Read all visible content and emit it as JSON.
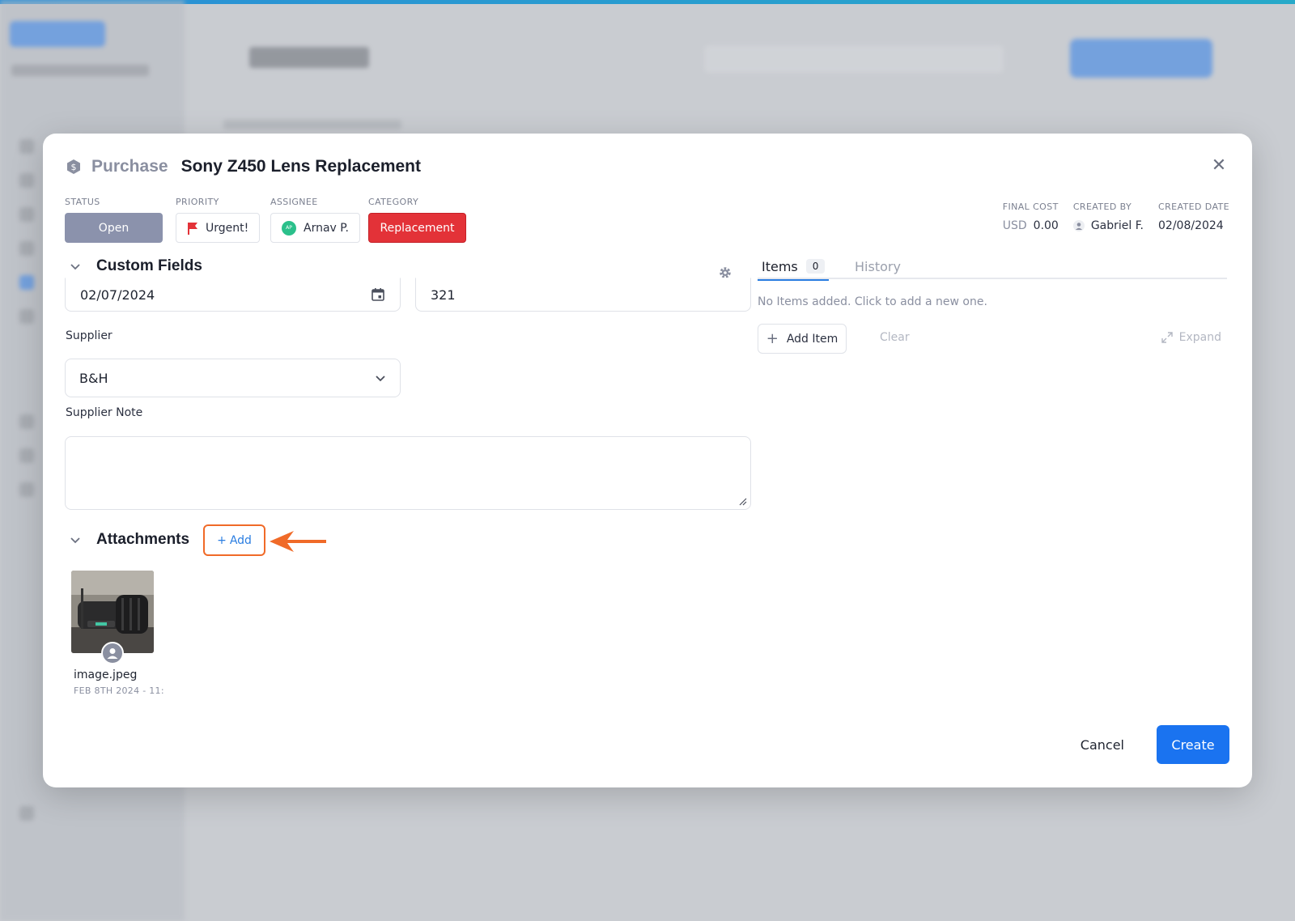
{
  "modal": {
    "type_label": "Purchase",
    "title": "Sony Z450 Lens Replacement",
    "status": {
      "label": "STATUS",
      "value": "Open"
    },
    "priority": {
      "label": "PRIORITY",
      "value": "Urgent!",
      "flag_color": "#e33238"
    },
    "assignee": {
      "label": "ASSIGNEE",
      "value": "Arnav P.",
      "initials": "AP"
    },
    "category": {
      "label": "CATEGORY",
      "value": "Replacement",
      "color": "#e33238"
    },
    "final_cost": {
      "label": "FINAL COST",
      "currency": "USD",
      "amount": "0.00"
    },
    "created_by": {
      "label": "CREATED BY",
      "value": "Gabriel F."
    },
    "created_date": {
      "label": "CREATED DATE",
      "value": "02/08/2024"
    }
  },
  "custom_fields": {
    "title": "Custom Fields",
    "date_value": "02/07/2024",
    "number_value": "321"
  },
  "supplier": {
    "label": "Supplier",
    "value": "B&H"
  },
  "supplier_note": {
    "label": "Supplier Note",
    "value": ""
  },
  "attachments": {
    "title": "Attachments",
    "add_label": "Add",
    "files": [
      {
        "name": "image.jpeg",
        "date": "FEB 8TH 2024 - 11:"
      }
    ]
  },
  "items_panel": {
    "tabs": [
      {
        "label": "Items",
        "count": "0"
      },
      {
        "label": "History"
      }
    ],
    "empty_text": "No Items added. Click to add a new one.",
    "add_item_label": "Add Item",
    "clear_label": "Clear",
    "expand_label": "Expand"
  },
  "footer": {
    "cancel_label": "Cancel",
    "create_label": "Create"
  },
  "colors": {
    "accent": "#1a73f0",
    "highlight": "#f06a28",
    "status": "#8b92ac"
  }
}
